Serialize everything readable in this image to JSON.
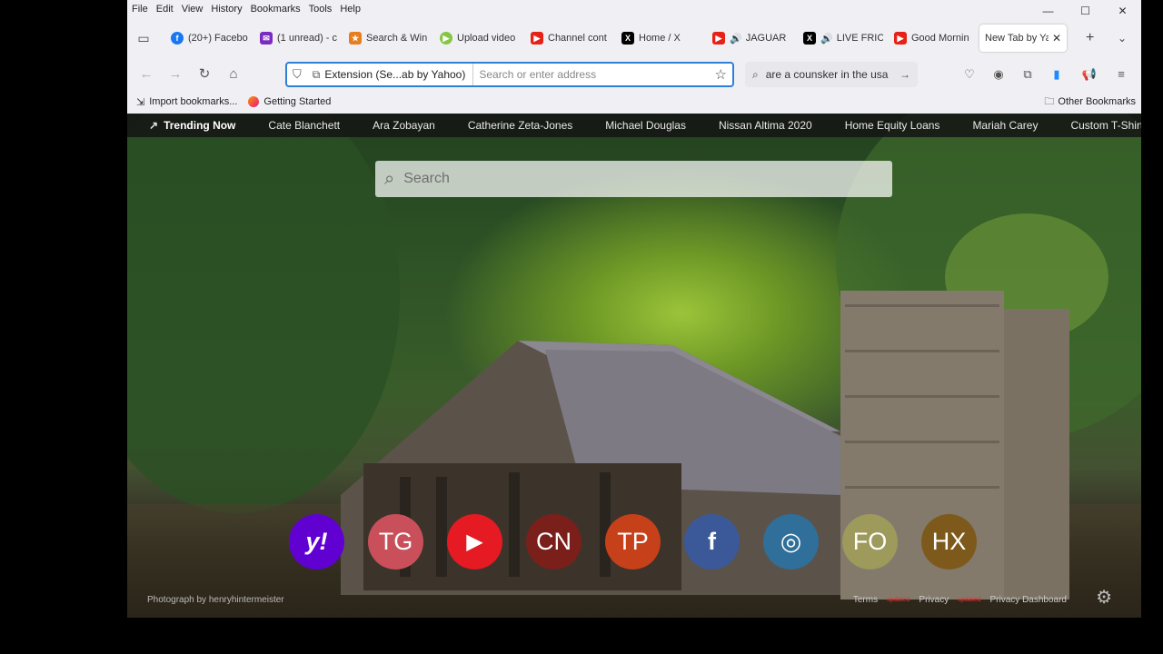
{
  "menu": [
    "File",
    "Edit",
    "View",
    "History",
    "Bookmarks",
    "Tools",
    "Help"
  ],
  "window_controls": {
    "minimize": "—",
    "maximize": "☐",
    "close": "✕"
  },
  "tabs": [
    {
      "label": "(20+) Facebo",
      "icon": "facebook-icon",
      "color": "#1877f2"
    },
    {
      "label": "(1 unread) - c",
      "icon": "mail-icon",
      "color": "#7b2cbf"
    },
    {
      "label": "Search & Win",
      "icon": "swagbucks-icon",
      "color": "#e87d1e"
    },
    {
      "label": "Upload video",
      "icon": "rumble-icon",
      "color": "#85c742"
    },
    {
      "label": "Channel cont",
      "icon": "youtube-icon",
      "color": "#e62117"
    },
    {
      "label": "Home / X",
      "icon": "x-icon",
      "color": "#000000"
    },
    {
      "label": "JAGUAR",
      "icon": "youtube-icon",
      "color": "#e62117"
    },
    {
      "label": "LIVE FRIC",
      "icon": "x-icon",
      "color": "#000000"
    },
    {
      "label": "Good Mornin",
      "icon": "youtube-icon",
      "color": "#e62117"
    },
    {
      "label": "New Tab by Ya",
      "icon": "none",
      "color": "#ffffff",
      "active": true
    }
  ],
  "urlbar": {
    "extension_label": "Extension (Se...ab by Yahoo)",
    "placeholder": "Search or enter address",
    "value": ""
  },
  "search_box": {
    "text": "are a counsker in the usa"
  },
  "bookmarks": [
    {
      "label": "Import bookmarks..."
    },
    {
      "label": "Getting Started"
    }
  ],
  "other_bookmarks": "Other Bookmarks",
  "trending": {
    "title": "Trending Now",
    "items": [
      "Cate Blanchett",
      "Ara Zobayan",
      "Catherine Zeta-Jones",
      "Michael Douglas",
      "Nissan Altima 2020",
      "Home Equity Loans",
      "Mariah Carey",
      "Custom T-Shirts"
    ]
  },
  "yahoo_search": {
    "placeholder": "Search"
  },
  "shortcuts": [
    {
      "label": "y!",
      "color": "#6001d2"
    },
    {
      "label": "TG",
      "color": "#c9505a"
    },
    {
      "label": "▶",
      "color": "#e51a22"
    },
    {
      "label": "CN",
      "color": "#7a1f1a"
    },
    {
      "label": "TP",
      "color": "#c6401a"
    },
    {
      "label": "f",
      "color": "#3b5998"
    },
    {
      "label": "◎",
      "color": "#2f6f9a"
    },
    {
      "label": "FO",
      "color": "#9d9a5c"
    },
    {
      "label": "HX",
      "color": "#7d5a1c"
    }
  ],
  "footer": {
    "photo_credit": "Photograph by henryhintermeister",
    "terms": "Terms",
    "privacy": "Privacy",
    "privacy_dashboard": "Privacy Dashboard",
    "updated": "updated"
  }
}
